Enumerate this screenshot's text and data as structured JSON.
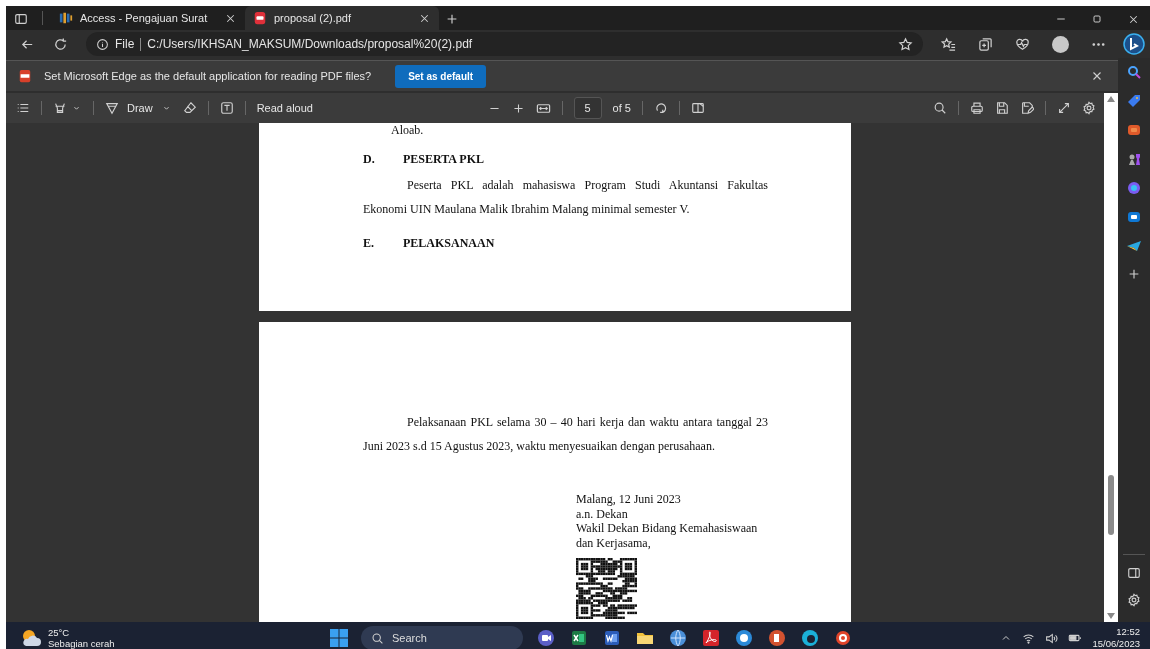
{
  "browser_tabs": [
    {
      "title": "Access - Pengajuan Surat",
      "selected": false,
      "kind": "web"
    },
    {
      "title": "proposal (2).pdf",
      "selected": true,
      "kind": "pdf"
    }
  ],
  "address_bar": {
    "scheme": "File",
    "url": "C:/Users/IKHSAN_MAKSUM/Downloads/proposal%20(2).pdf"
  },
  "info_bar": {
    "message": "Set Microsoft Edge as the default application for reading PDF files?",
    "button": "Set as default"
  },
  "pdf_toolbar": {
    "draw_label": "Draw",
    "read_aloud": "Read aloud",
    "page_number": "5",
    "page_count": "of 5"
  },
  "pages": [
    {
      "blocks": [
        {
          "kind": "cut",
          "text": "Aloab."
        },
        {
          "kind": "heading",
          "number": "D.",
          "text": "PESERTA PKL"
        },
        {
          "kind": "paragraph",
          "lines": [
            "Peserta PKL adalah mahasiswa Program Studi Akuntansi Fakultas",
            "Ekonomi UIN Maulana Malik Ibrahim Malang minimal semester V."
          ]
        },
        {
          "kind": "heading",
          "number": "E.",
          "text": "PELAKSANAAN"
        }
      ]
    },
    {
      "blocks": [
        {
          "kind": "paragraph",
          "lines": [
            "Pelaksanaan PKL selama 30 – 40 hari kerja dan waktu antara tanggal 23",
            "Juni 2023 s.d 15 Agustus 2023, waktu menyesuaikan dengan perusahaan."
          ]
        },
        {
          "kind": "signature",
          "lines": [
            "Malang, 12 Juni 2023",
            "a.n. Dekan",
            "Wakil Dekan Bidang Kemahasiswaan",
            "dan Kerjasama,"
          ]
        },
        {
          "kind": "qr"
        }
      ]
    }
  ],
  "taskbar": {
    "temperature": "25°C",
    "weather": "Sebagian cerah",
    "search_label": "Search",
    "time": "12:52",
    "date": "15/06/2023"
  }
}
